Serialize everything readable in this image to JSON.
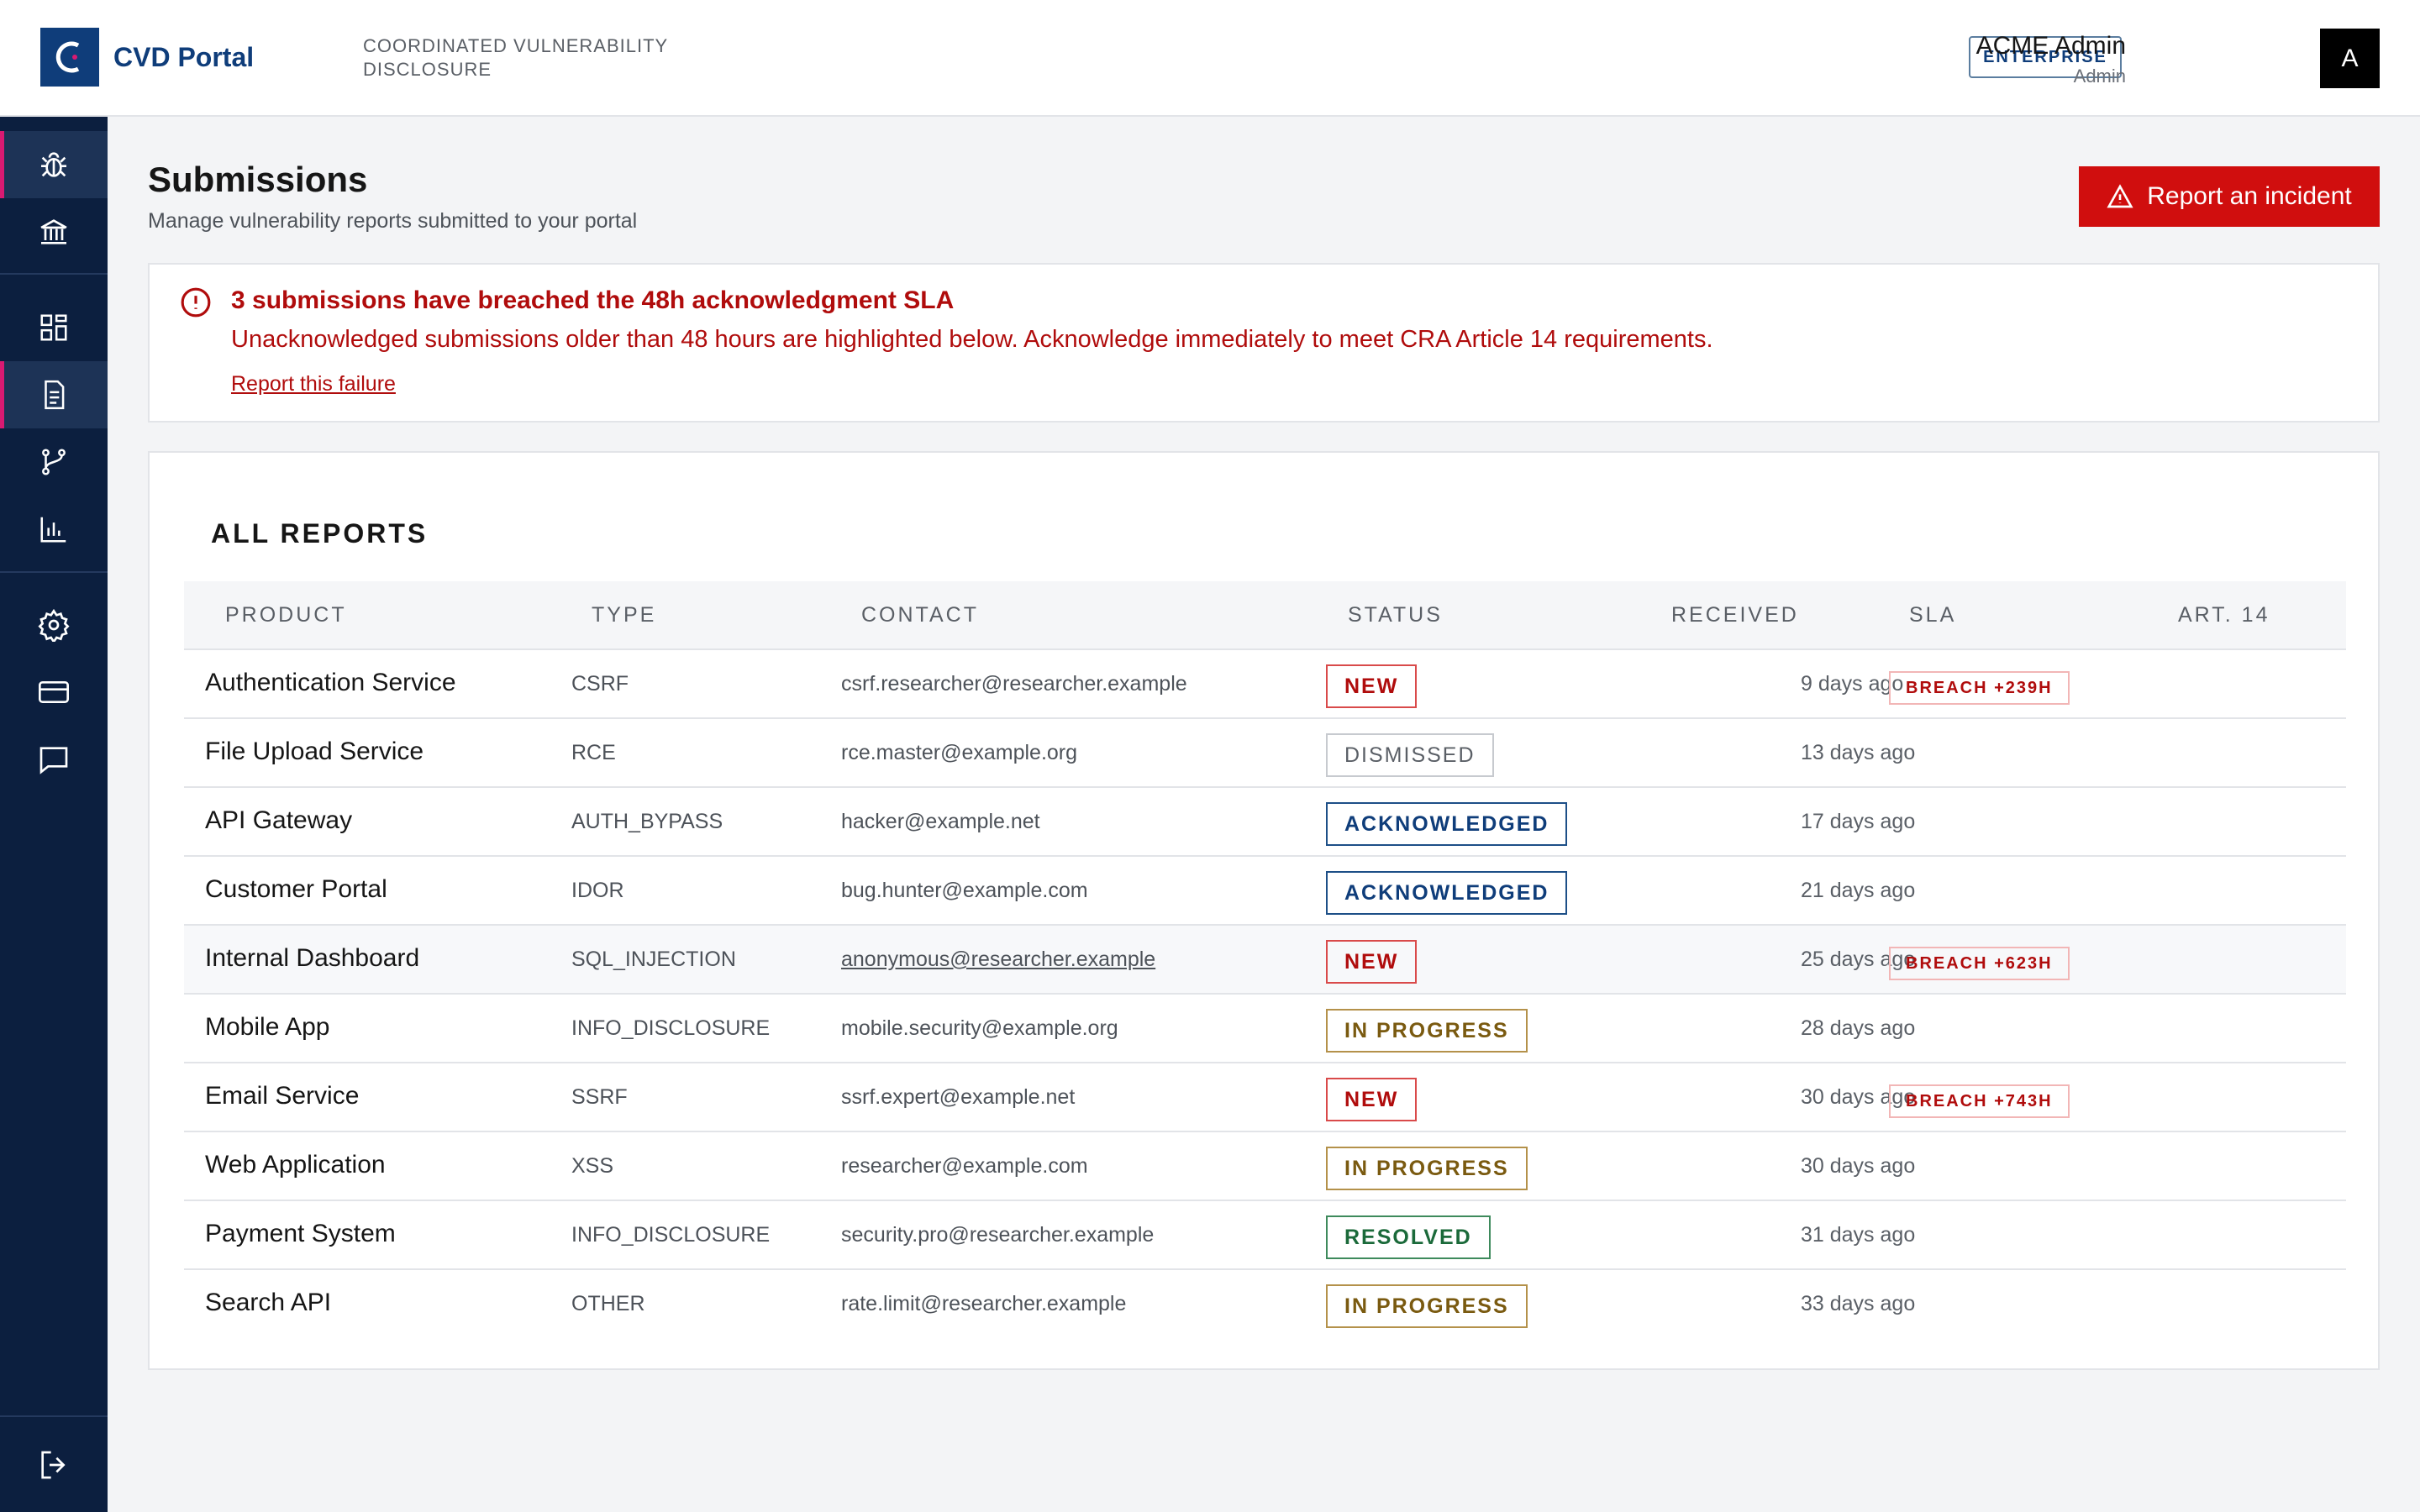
{
  "header": {
    "logo_text": "CVD Portal",
    "subtitle": "COORDINATED VULNERABILITY DISCLOSURE",
    "plan_badge": "ENTERPRISE",
    "user_name": "ACME Admin",
    "user_role": "Admin",
    "avatar_initial": "A"
  },
  "sidebar": {
    "items": [
      {
        "icon": "bug-icon",
        "active": true
      },
      {
        "icon": "institution-icon",
        "active": false
      },
      {
        "icon": "dashboard-icon",
        "active": false
      },
      {
        "icon": "document-icon",
        "active": true
      },
      {
        "icon": "branch-icon",
        "active": false
      },
      {
        "icon": "bar-chart-icon",
        "active": false
      },
      {
        "icon": "gear-icon",
        "active": false
      },
      {
        "icon": "credit-card-icon",
        "active": false
      },
      {
        "icon": "chat-icon",
        "active": false
      },
      {
        "icon": "logout-icon",
        "active": false
      }
    ]
  },
  "page": {
    "title": "Submissions",
    "subtitle": "Manage vulnerability reports submitted to your portal",
    "report_button": "Report an incident"
  },
  "alert": {
    "title": "3 submissions have breached the 48h acknowledgment SLA",
    "body": "Unacknowledged submissions older than 48 hours are highlighted below. Acknowledge immediately to meet CRA Article 14 requirements.",
    "link": "Report this failure"
  },
  "table": {
    "title": "ALL REPORTS",
    "columns": [
      "PRODUCT",
      "TYPE",
      "CONTACT",
      "STATUS",
      "RECEIVED",
      "SLA",
      "ART. 14"
    ],
    "rows": [
      {
        "product": "Authentication Service",
        "type": "CSRF",
        "contact": "csrf.researcher@researcher.example",
        "status": "NEW",
        "received": "9 days ago",
        "sla": "BREACH +239H",
        "art14": ""
      },
      {
        "product": "File Upload Service",
        "type": "RCE",
        "contact": "rce.master@example.org",
        "status": "DISMISSED",
        "received": "13 days ago",
        "sla": "",
        "art14": ""
      },
      {
        "product": "API Gateway",
        "type": "AUTH_BYPASS",
        "contact": "hacker@example.net",
        "status": "ACKNOWLEDGED",
        "received": "17 days ago",
        "sla": "",
        "art14": ""
      },
      {
        "product": "Customer Portal",
        "type": "IDOR",
        "contact": "bug.hunter@example.com",
        "status": "ACKNOWLEDGED",
        "received": "21 days ago",
        "sla": "",
        "art14": ""
      },
      {
        "product": "Internal Dashboard",
        "type": "SQL_INJECTION",
        "contact": "anonymous@researcher.example",
        "status": "NEW",
        "received": "25 days ago",
        "sla": "BREACH +623H",
        "art14": ""
      },
      {
        "product": "Mobile App",
        "type": "INFO_DISCLOSURE",
        "contact": "mobile.security@example.org",
        "status": "IN PROGRESS",
        "received": "28 days ago",
        "sla": "",
        "art14": ""
      },
      {
        "product": "Email Service",
        "type": "SSRF",
        "contact": "ssrf.expert@example.net",
        "status": "NEW",
        "received": "30 days ago",
        "sla": "BREACH +743H",
        "art14": ""
      },
      {
        "product": "Web Application",
        "type": "XSS",
        "contact": "researcher@example.com",
        "status": "IN PROGRESS",
        "received": "30 days ago",
        "sla": "",
        "art14": ""
      },
      {
        "product": "Payment System",
        "type": "INFO_DISCLOSURE",
        "contact": "security.pro@researcher.example",
        "status": "RESOLVED",
        "received": "31 days ago",
        "sla": "",
        "art14": ""
      },
      {
        "product": "Search API",
        "type": "OTHER",
        "contact": "rate.limit@researcher.example",
        "status": "IN PROGRESS",
        "received": "33 days ago",
        "sla": "",
        "art14": ""
      }
    ]
  },
  "colors": {
    "brand": "#0f3d7a",
    "sidebar": "#0c1f3f",
    "danger": "#d00e0e",
    "accent": "#d91a72"
  }
}
